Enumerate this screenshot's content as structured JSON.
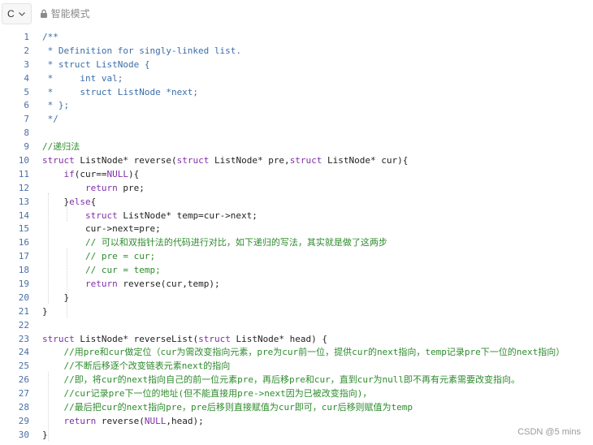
{
  "toolbar": {
    "language": "C",
    "mode_label": "智能模式",
    "icons": [
      "chevron-down-icon",
      "lock-icon"
    ]
  },
  "editor": {
    "lines": [
      {
        "n": "1",
        "text": "/**"
      },
      {
        "n": "2",
        "text": " * Definition for singly-linked list."
      },
      {
        "n": "3",
        "text": " * struct ListNode {"
      },
      {
        "n": "4",
        "text": " *     int val;"
      },
      {
        "n": "5",
        "text": " *     struct ListNode *next;"
      },
      {
        "n": "6",
        "text": " * };"
      },
      {
        "n": "7",
        "text": " */"
      },
      {
        "n": "8",
        "text": ""
      },
      {
        "n": "9",
        "text": "//递归法"
      },
      {
        "n": "10",
        "text": "struct ListNode* reverse(struct ListNode* pre,struct ListNode* cur){"
      },
      {
        "n": "11",
        "text": "    if(cur==NULL){"
      },
      {
        "n": "12",
        "text": "        return pre;"
      },
      {
        "n": "13",
        "text": "    }else{"
      },
      {
        "n": "14",
        "text": "        struct ListNode* temp=cur->next;"
      },
      {
        "n": "15",
        "text": "        cur->next=pre;"
      },
      {
        "n": "16",
        "text": "        // 可以和双指针法的代码进行对比，如下递归的写法，其实就是做了这两步"
      },
      {
        "n": "17",
        "text": "        // pre = cur;"
      },
      {
        "n": "18",
        "text": "        // cur = temp;"
      },
      {
        "n": "19",
        "text": "        return reverse(cur,temp);"
      },
      {
        "n": "20",
        "text": "    }"
      },
      {
        "n": "21",
        "text": "}"
      },
      {
        "n": "22",
        "text": ""
      },
      {
        "n": "23",
        "text": "struct ListNode* reverseList(struct ListNode* head) {"
      },
      {
        "n": "24",
        "text": "    //用pre和cur做定位（cur为需改变指向元素，pre为cur前一位，提供cur的next指向，temp记录pre下一位的next指向）"
      },
      {
        "n": "25",
        "text": "    //不断后移逐个改变链表元素next的指向"
      },
      {
        "n": "26",
        "text": "    //即，将cur的next指向自己的前一位元素pre，再后移pre和cur，直到cur为null即不再有元素需要改变指向。"
      },
      {
        "n": "27",
        "text": "    //cur记录pre下一位的地址(但不能直接用pre->next因为已被改变指向)，"
      },
      {
        "n": "28",
        "text": "    //最后把cur的next指向pre，pre后移则直接赋值为cur即可，cur后移则赋值为temp"
      },
      {
        "n": "29",
        "text": "    return reverse(NULL,head);"
      },
      {
        "n": "30",
        "text": "}"
      }
    ]
  },
  "watermark": "CSDN @5 mins",
  "colors": {
    "keyword": "#7f2fa7",
    "doc_comment": "#3b6ea8",
    "line_comment": "#2e8b2e",
    "line_number": "#4a6fa5",
    "text": "#1f1f1f"
  }
}
